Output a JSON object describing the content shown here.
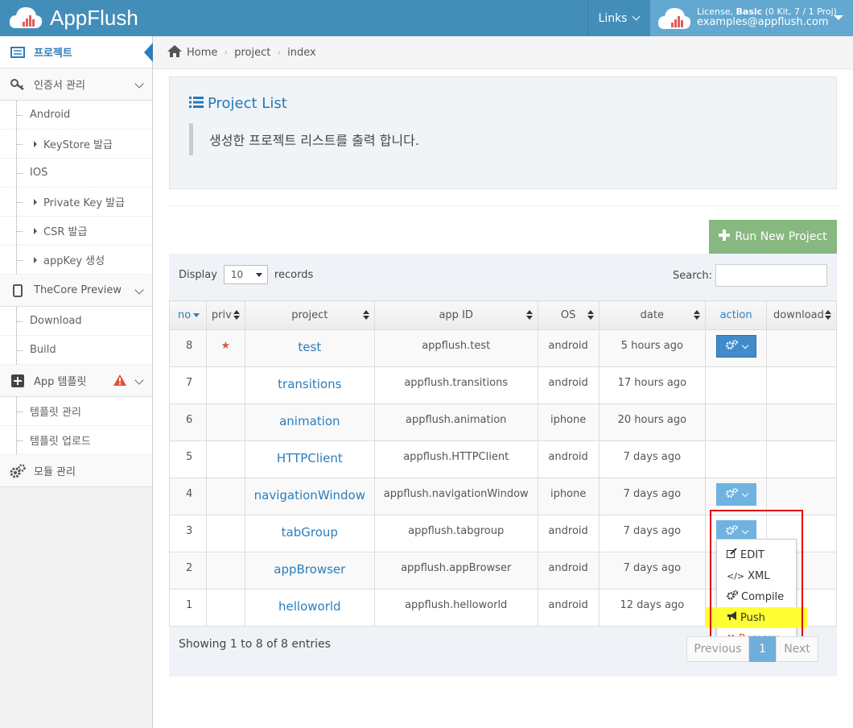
{
  "header": {
    "app_name": "AppFlush",
    "links_label": "Links",
    "license_text": "License, ",
    "license_plan": "Basic",
    "license_info": " (0 Kit, 7 / 1 Proj)",
    "user_email": "examples@appflush.com"
  },
  "sidebar": {
    "project": "프로젝트",
    "cert_mgmt": "인증서 관리",
    "android": "Android",
    "keystore": "KeyStore 발급",
    "ios": "IOS",
    "private_key": "Private Key 발급",
    "csr": "CSR 발급",
    "appkey": "appKey 생성",
    "thecore": "TheCore Preview",
    "download": "Download",
    "build": "Build",
    "app_template": "App 템플릿",
    "template_mgmt": "템플릿 관리",
    "template_upload": "템플릿 업로드",
    "module_mgmt": "모듈 관리"
  },
  "breadcrumb": [
    "Home",
    "project",
    "index"
  ],
  "page": {
    "title": "Project List",
    "description": "생성한 프로젝트 리스트를 출력 합니다.",
    "run_button": "Run New Project"
  },
  "table": {
    "display": "Display",
    "records_value": "10",
    "records": "records",
    "search_label": "Search:",
    "columns": [
      "no",
      "priv",
      "project",
      "app ID",
      "OS",
      "date",
      "action",
      "download"
    ],
    "rows": [
      {
        "no": "8",
        "priv": "★",
        "project": "test",
        "app_id": "appflush.test",
        "os": "android",
        "date": "5 hours ago"
      },
      {
        "no": "7",
        "priv": "",
        "project": "transitions",
        "app_id": "appflush.transitions",
        "os": "android",
        "date": "17 hours ago"
      },
      {
        "no": "6",
        "priv": "",
        "project": "animation",
        "app_id": "appflush.animation",
        "os": "iphone",
        "date": "20 hours ago"
      },
      {
        "no": "5",
        "priv": "",
        "project": "HTTPClient",
        "app_id": "appflush.HTTPClient",
        "os": "android",
        "date": "7 days ago"
      },
      {
        "no": "4",
        "priv": "",
        "project": "navigationWindow",
        "app_id": "appflush.navigationWindow",
        "os": "iphone",
        "date": "7 days ago"
      },
      {
        "no": "3",
        "priv": "",
        "project": "tabGroup",
        "app_id": "appflush.tabgroup",
        "os": "android",
        "date": "7 days ago"
      },
      {
        "no": "2",
        "priv": "",
        "project": "appBrowser",
        "app_id": "appflush.appBrowser",
        "os": "android",
        "date": "7 days ago"
      },
      {
        "no": "1",
        "priv": "",
        "project": "helloworld",
        "app_id": "appflush.helloworld",
        "os": "android",
        "date": "12 days ago"
      }
    ],
    "dropdown": {
      "edit": "EDIT",
      "xml": "XML",
      "compile": "Compile",
      "push": "Push",
      "remove": "Remove"
    },
    "showing": "Showing 1 to 8 of 8 entries",
    "pager": {
      "previous": "Previous",
      "current": "1",
      "next": "Next"
    }
  },
  "colors": {
    "brand": "#438eb9",
    "accent": "#2b7dbc",
    "success": "#87b87f",
    "highlight": "#ffff33",
    "danger": "#e3000f"
  }
}
